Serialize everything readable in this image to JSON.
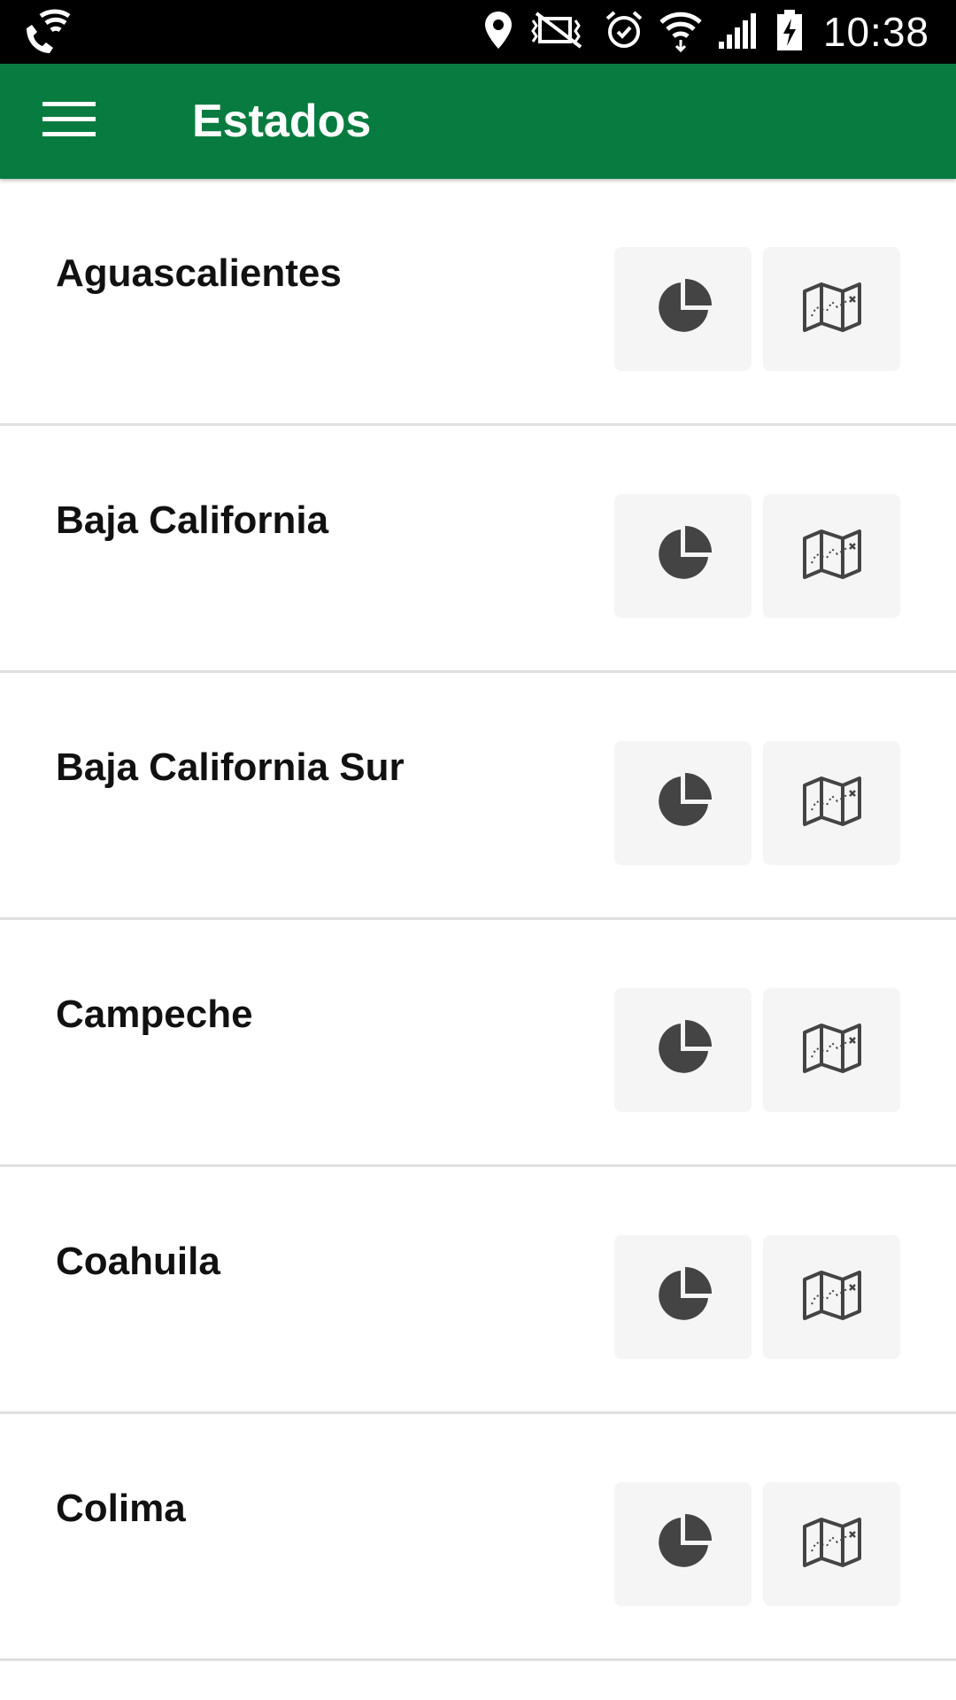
{
  "status_bar": {
    "time": "10:38",
    "icons": [
      "wifi-call-icon",
      "location-icon",
      "nfc-muted-icon",
      "alarm-icon",
      "wifi-icon",
      "signal-icon",
      "battery-charging-icon"
    ]
  },
  "app_bar": {
    "title": "Estados",
    "menu_icon": "hamburger-menu-icon",
    "background_color": "#087c40"
  },
  "states": [
    {
      "name": "Aguascalientes",
      "stats_icon": "pie-chart-icon",
      "map_icon": "map-icon"
    },
    {
      "name": "Baja California",
      "stats_icon": "pie-chart-icon",
      "map_icon": "map-icon"
    },
    {
      "name": "Baja California Sur",
      "stats_icon": "pie-chart-icon",
      "map_icon": "map-icon"
    },
    {
      "name": "Campeche",
      "stats_icon": "pie-chart-icon",
      "map_icon": "map-icon"
    },
    {
      "name": "Coahuila",
      "stats_icon": "pie-chart-icon",
      "map_icon": "map-icon"
    },
    {
      "name": "Colima",
      "stats_icon": "pie-chart-icon",
      "map_icon": "map-icon"
    }
  ],
  "colors": {
    "icon": "#444444",
    "button_bg": "#f5f5f5",
    "divider": "#e0e0e0"
  }
}
